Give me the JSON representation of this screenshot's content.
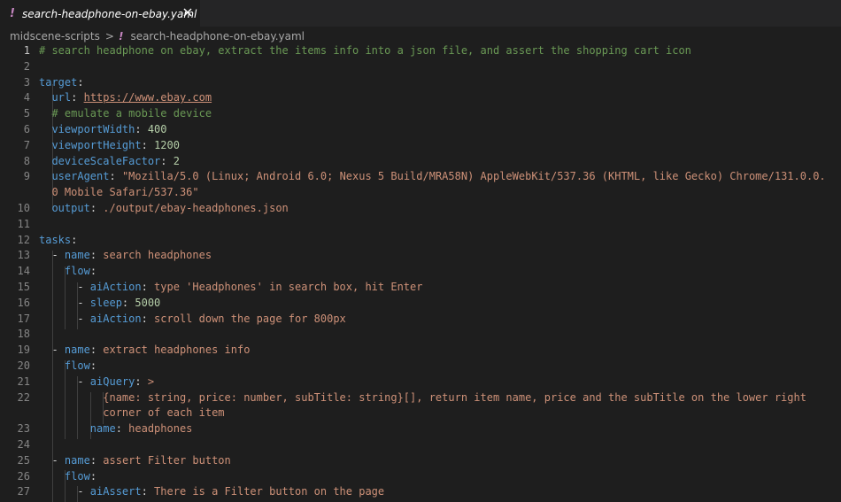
{
  "tab": {
    "file_icon": "!",
    "title": "search-headphone-on-ebay.yaml",
    "close_icon": "close-icon"
  },
  "breadcrumb": {
    "folder": "midscene-scripts",
    "separator": ">",
    "file_icon": "!",
    "file": "search-headphone-on-ebay.yaml"
  },
  "colors": {
    "background": "#1e1e1e",
    "tabbar": "#252526",
    "key": "#569cd6",
    "string": "#ce9178",
    "number": "#b5cea8",
    "comment": "#6a9955",
    "line_number": "#858585"
  },
  "lines": [
    {
      "n": "1",
      "tokens": [
        [
          "cmt",
          "# search headphone on ebay, extract the items info into a json file, and assert the shopping cart icon"
        ]
      ]
    },
    {
      "n": "2",
      "tokens": []
    },
    {
      "n": "3",
      "tokens": [
        [
          "key",
          "target"
        ],
        [
          "punc",
          ":"
        ]
      ]
    },
    {
      "n": "4",
      "tokens": [
        [
          "punc",
          "  "
        ],
        [
          "key",
          "url"
        ],
        [
          "punc",
          ": "
        ],
        [
          "link",
          "https://www.ebay.com"
        ]
      ]
    },
    {
      "n": "5",
      "tokens": [
        [
          "punc",
          "  "
        ],
        [
          "cmt",
          "# emulate a mobile device"
        ]
      ]
    },
    {
      "n": "6",
      "tokens": [
        [
          "punc",
          "  "
        ],
        [
          "key",
          "viewportWidth"
        ],
        [
          "punc",
          ": "
        ],
        [
          "num",
          "400"
        ]
      ]
    },
    {
      "n": "7",
      "tokens": [
        [
          "punc",
          "  "
        ],
        [
          "key",
          "viewportHeight"
        ],
        [
          "punc",
          ": "
        ],
        [
          "num",
          "1200"
        ]
      ]
    },
    {
      "n": "8",
      "tokens": [
        [
          "punc",
          "  "
        ],
        [
          "key",
          "deviceScaleFactor"
        ],
        [
          "punc",
          ": "
        ],
        [
          "num",
          "2"
        ]
      ]
    },
    {
      "n": "9",
      "tokens": [
        [
          "punc",
          "  "
        ],
        [
          "key",
          "userAgent"
        ],
        [
          "punc",
          ": "
        ],
        [
          "str",
          "\"Mozilla/5.0 (Linux; Android 6.0; Nexus 5 Build/MRA58N) AppleWebKit/537.36 (KHTML, like Gecko) Chrome/131.0.0."
        ]
      ]
    },
    {
      "n": "",
      "tokens": [
        [
          "punc",
          "  "
        ],
        [
          "str",
          "0 Mobile Safari/537.36\""
        ]
      ]
    },
    {
      "n": "10",
      "tokens": [
        [
          "punc",
          "  "
        ],
        [
          "key",
          "output"
        ],
        [
          "punc",
          ": "
        ],
        [
          "str",
          "./output/ebay-headphones.json"
        ]
      ]
    },
    {
      "n": "11",
      "tokens": []
    },
    {
      "n": "12",
      "tokens": [
        [
          "key",
          "tasks"
        ],
        [
          "punc",
          ":"
        ]
      ]
    },
    {
      "n": "13",
      "tokens": [
        [
          "punc",
          "  - "
        ],
        [
          "key",
          "name"
        ],
        [
          "punc",
          ": "
        ],
        [
          "str",
          "search headphones"
        ]
      ]
    },
    {
      "n": "14",
      "tokens": [
        [
          "punc",
          "    "
        ],
        [
          "key",
          "flow"
        ],
        [
          "punc",
          ":"
        ]
      ]
    },
    {
      "n": "15",
      "tokens": [
        [
          "punc",
          "      - "
        ],
        [
          "key",
          "aiAction"
        ],
        [
          "punc",
          ": "
        ],
        [
          "str",
          "type 'Headphones' in search box, hit Enter"
        ]
      ]
    },
    {
      "n": "16",
      "tokens": [
        [
          "punc",
          "      - "
        ],
        [
          "key",
          "sleep"
        ],
        [
          "punc",
          ": "
        ],
        [
          "num",
          "5000"
        ]
      ]
    },
    {
      "n": "17",
      "tokens": [
        [
          "punc",
          "      - "
        ],
        [
          "key",
          "aiAction"
        ],
        [
          "punc",
          ": "
        ],
        [
          "str",
          "scroll down the page for 800px"
        ]
      ]
    },
    {
      "n": "18",
      "tokens": []
    },
    {
      "n": "19",
      "tokens": [
        [
          "punc",
          "  - "
        ],
        [
          "key",
          "name"
        ],
        [
          "punc",
          ": "
        ],
        [
          "str",
          "extract headphones info"
        ]
      ]
    },
    {
      "n": "20",
      "tokens": [
        [
          "punc",
          "    "
        ],
        [
          "key",
          "flow"
        ],
        [
          "punc",
          ":"
        ]
      ]
    },
    {
      "n": "21",
      "tokens": [
        [
          "punc",
          "      - "
        ],
        [
          "key",
          "aiQuery"
        ],
        [
          "punc",
          ": "
        ],
        [
          "str",
          ">"
        ]
      ]
    },
    {
      "n": "22",
      "tokens": [
        [
          "punc",
          "          "
        ],
        [
          "str",
          "{name: string, price: number, subTitle: string}[], return item name, price and the subTitle on the lower right"
        ]
      ]
    },
    {
      "n": "",
      "tokens": [
        [
          "punc",
          "          "
        ],
        [
          "str",
          "corner of each item"
        ]
      ]
    },
    {
      "n": "23",
      "tokens": [
        [
          "punc",
          "        "
        ],
        [
          "key",
          "name"
        ],
        [
          "punc",
          ": "
        ],
        [
          "str",
          "headphones"
        ]
      ]
    },
    {
      "n": "24",
      "tokens": []
    },
    {
      "n": "25",
      "tokens": [
        [
          "punc",
          "  - "
        ],
        [
          "key",
          "name"
        ],
        [
          "punc",
          ": "
        ],
        [
          "str",
          "assert Filter button"
        ]
      ]
    },
    {
      "n": "26",
      "tokens": [
        [
          "punc",
          "    "
        ],
        [
          "key",
          "flow"
        ],
        [
          "punc",
          ":"
        ]
      ]
    },
    {
      "n": "27",
      "tokens": [
        [
          "punc",
          "      - "
        ],
        [
          "key",
          "aiAssert"
        ],
        [
          "punc",
          ": "
        ],
        [
          "str",
          "There is a Filter button on the page"
        ]
      ]
    }
  ]
}
